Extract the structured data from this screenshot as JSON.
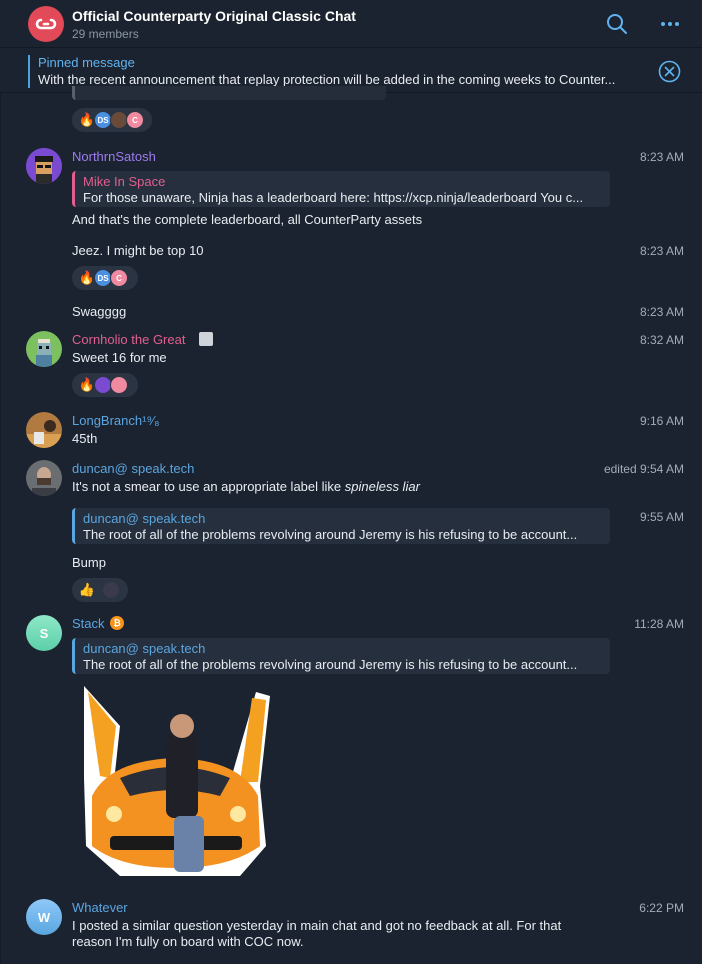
{
  "header": {
    "title": "Official Counterparty Original Classic Chat",
    "members": "29 members",
    "avatar_color": "#e24a59",
    "icons": [
      "search-icon",
      "more-icon"
    ]
  },
  "pinned": {
    "title": "Pinned message",
    "text": "With the recent announcement that replay protection will be added in the coming weeks to Counter..."
  },
  "reactions_top": {
    "emoji": "🔥",
    "avatars": [
      "DS",
      "",
      "C"
    ]
  },
  "messages": {
    "northrn": {
      "sender": "NorthrnSatosh",
      "sender_color": "#9d7cf0",
      "time": "8:23 AM",
      "quote_name": "Mike In Space",
      "quote_text": "For those unaware, Ninja has a leaderboard here: https://xcp.ninja/leaderboard  You c...",
      "text": "And that's the complete leaderboard, all CounterParty assets"
    },
    "jeez": {
      "text": "Jeez. I might be top 10",
      "time": "8:23 AM",
      "reaction": "🔥",
      "avatars": [
        "DS",
        "C"
      ]
    },
    "swag": {
      "text": "Swagggg",
      "time": "8:23 AM"
    },
    "cornholio": {
      "sender": "Cornholio the Great",
      "sender_color": "#e15f8f",
      "time": "8:32 AM",
      "text": "Sweet 16 for me",
      "reaction": "🔥"
    },
    "longbranch": {
      "sender": "LongBranch¹⁹⁄₈",
      "sender_color": "#5aa6e0",
      "time": "9:16 AM",
      "text": "45th"
    },
    "duncan": {
      "sender": "duncan@ speak.tech",
      "sender_color": "#5aa6e0",
      "time": "edited 9:54 AM",
      "text_plain": "It's not a smear to use an appropriate label like ",
      "text_italic": "spineless liar"
    },
    "duncan2": {
      "time": "9:55 AM",
      "quote_name": "duncan@ speak.tech",
      "quote_text": "The root of all of the problems  revolving around Jeremy is his refusing to be account...",
      "text": "Bump",
      "reaction": "👍"
    },
    "stack": {
      "sender": "Stack",
      "sender_color": "#5aa6e0",
      "avatar_letter": "S",
      "time": "11:28 AM",
      "quote_name": "duncan@ speak.tech",
      "quote_text": "The root of all of the problems  revolving around Jeremy is his refusing to be account..."
    },
    "whatever": {
      "sender": "Whatever",
      "sender_color": "#5aa6e0",
      "avatar_letter": "W",
      "time": "6:22 PM",
      "line1": "I posted a similar question yesterday in main chat and got no feedback at all. For that",
      "line2": "reason I'm fully on board with COC now."
    }
  }
}
